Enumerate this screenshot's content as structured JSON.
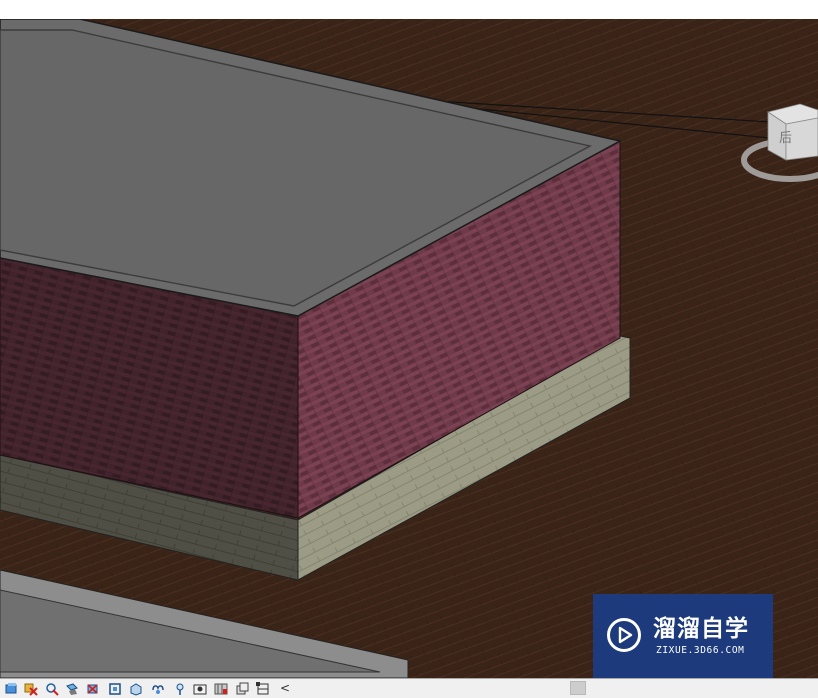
{
  "viewcube": {
    "face_label": "后"
  },
  "view_control_bar": {
    "icons": [
      "detail-level-icon",
      "visual-style-icon",
      "sun-path-icon",
      "shadows-icon",
      "rendering-icon",
      "crop-region-icon",
      "show-crop-icon",
      "unlock-3d-view-icon",
      "temporary-hide-icon",
      "reveal-hidden-icon",
      "temporary-view-properties-icon",
      "worksharing-display-icon",
      "analytical-model-icon",
      "highlight-displacement-icon"
    ],
    "collapse_glyph": "<"
  },
  "watermark": {
    "title": "溜溜自学",
    "subtitle": "ZIXUE.3D66.COM"
  },
  "colors": {
    "ground": "#3a2418",
    "roof": "#6b6b6b",
    "roof_inner": "#5c5c5c",
    "brick_front": "#6b3645",
    "brick_side": "#3d2129",
    "plinth_front": "#9a9a85",
    "plinth_side": "#4f4f45",
    "watermark_bg": "#1d3a7c"
  }
}
